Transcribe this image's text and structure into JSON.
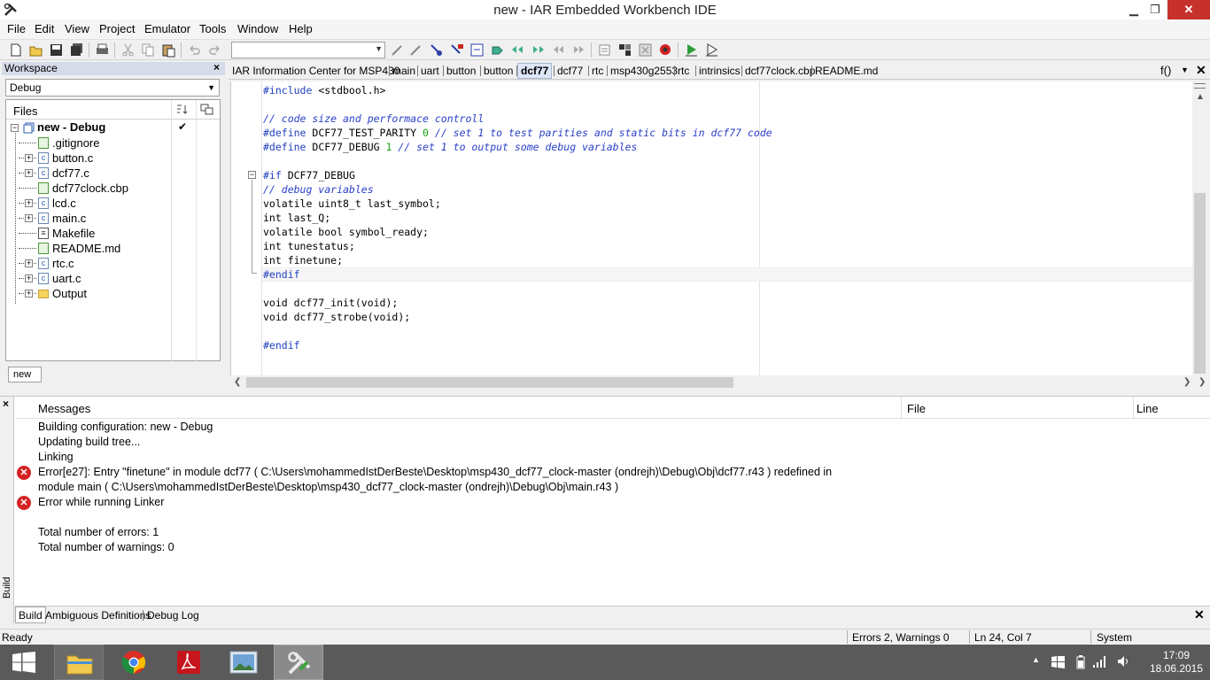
{
  "window": {
    "title": "new - IAR Embedded Workbench IDE",
    "minimize": "▁",
    "restore": "❐",
    "close": "✕"
  },
  "menu": [
    "File",
    "Edit",
    "View",
    "Project",
    "Emulator",
    "Tools",
    "Window",
    "Help"
  ],
  "toolbar": {
    "combo_value": ""
  },
  "workspace": {
    "header": "Workspace",
    "close": "×",
    "config": "Debug",
    "files_label": "Files",
    "project": "new - Debug",
    "project_check": "✔",
    "tab": "new",
    "items": [
      {
        "name": ".gitignore",
        "icon": "file",
        "expandable": false
      },
      {
        "name": "button.c",
        "icon": "c-file",
        "expandable": true
      },
      {
        "name": "dcf77.c",
        "icon": "c-file",
        "expandable": true
      },
      {
        "name": "dcf77clock.cbp",
        "icon": "file",
        "expandable": false
      },
      {
        "name": "lcd.c",
        "icon": "c-file",
        "expandable": true
      },
      {
        "name": "main.c",
        "icon": "c-file",
        "expandable": true
      },
      {
        "name": "Makefile",
        "icon": "makefile",
        "expandable": false
      },
      {
        "name": "README.md",
        "icon": "file",
        "expandable": false
      },
      {
        "name": "rtc.c",
        "icon": "c-file",
        "expandable": true
      },
      {
        "name": "uart.c",
        "icon": "c-file",
        "expandable": true
      },
      {
        "name": "Output",
        "icon": "folder",
        "expandable": true
      }
    ]
  },
  "editor": {
    "tabs": [
      "IAR Information Center for MSP430",
      "main",
      "uart",
      "button",
      "button",
      "dcf77",
      "dcf77",
      "rtc",
      "msp430g2553",
      "rtc",
      "intrinsics",
      "dcf77clock.cbp",
      "README.md"
    ],
    "active_tab_index": 5,
    "function_indicator": "f()",
    "code": {
      "l1_pp": "#include",
      "l1_rest": " <stdbool.h>",
      "l3_cm": "// code size and performace controll",
      "l4_pp": "#define",
      "l4_rest": " DCF77_TEST_PARITY ",
      "l4_num": "0",
      "l4_cm": " // set 1 to test parities and static bits in dcf77 code",
      "l5_pp": "#define",
      "l5_rest": " DCF77_DEBUG ",
      "l5_num": "1",
      "l5_cm": " // set 1 to output some debug variables",
      "l7_pp": "#if",
      "l7_rest": " DCF77_DEBUG",
      "l8_cm": "// debug variables",
      "l9": "volatile uint8_t last_symbol;",
      "l10": "int last_Q;",
      "l11": "volatile bool symbol_ready;",
      "l12": "int tunestatus;",
      "l13": "int finetune;",
      "l14_pp": "#endif",
      "l16": "void dcf77_init(void);",
      "l17": "void dcf77_strobe(void);",
      "l19_pp": "#endif"
    }
  },
  "messages": {
    "columns": {
      "messages": "Messages",
      "file": "File",
      "line": "Line"
    },
    "side_close": "×",
    "side_label": "Build",
    "lines": [
      {
        "text": "Building configuration: new - Debug",
        "error": false
      },
      {
        "text": "Updating build tree...",
        "error": false
      },
      {
        "text": "Linking",
        "error": false
      },
      {
        "text": "Error[e27]: Entry \"finetune\" in module dcf77 ( C:\\Users\\mohammedIstDerBeste\\Desktop\\msp430_dcf77_clock-master (ondrejh)\\Debug\\Obj\\dcf77.r43 ) redefined in",
        "error": true
      },
      {
        "text": "module main ( C:\\Users\\mohammedIstDerBeste\\Desktop\\msp430_dcf77_clock-master (ondrejh)\\Debug\\Obj\\main.r43 )",
        "error": false
      },
      {
        "text": "Error while running Linker",
        "error": true
      },
      {
        "text": "",
        "error": false
      },
      {
        "text": "Total number of errors: 1",
        "error": false
      },
      {
        "text": "Total number of warnings: 0",
        "error": false
      }
    ]
  },
  "bottom_tabs": [
    "Build",
    "Ambiguous Definitions",
    "Debug Log"
  ],
  "bottom_close": "✕",
  "status": {
    "ready": "Ready",
    "errors": "Errors 2, Warnings 0",
    "position": "Ln 24, Col 7",
    "mode": "System"
  },
  "taskbar": {
    "time": "17:09",
    "date": "18.06.2015",
    "apps": [
      "windows-start-icon",
      "file-explorer-icon",
      "chrome-icon",
      "acrobat-icon",
      "photo-viewer-icon",
      "iar-workbench-icon"
    ]
  },
  "colors": {
    "preprocessor": "#1f3fbf",
    "comment": "#2a40c8",
    "number": "#19a019",
    "error": "#d42222",
    "close_button": "#c7312c"
  }
}
